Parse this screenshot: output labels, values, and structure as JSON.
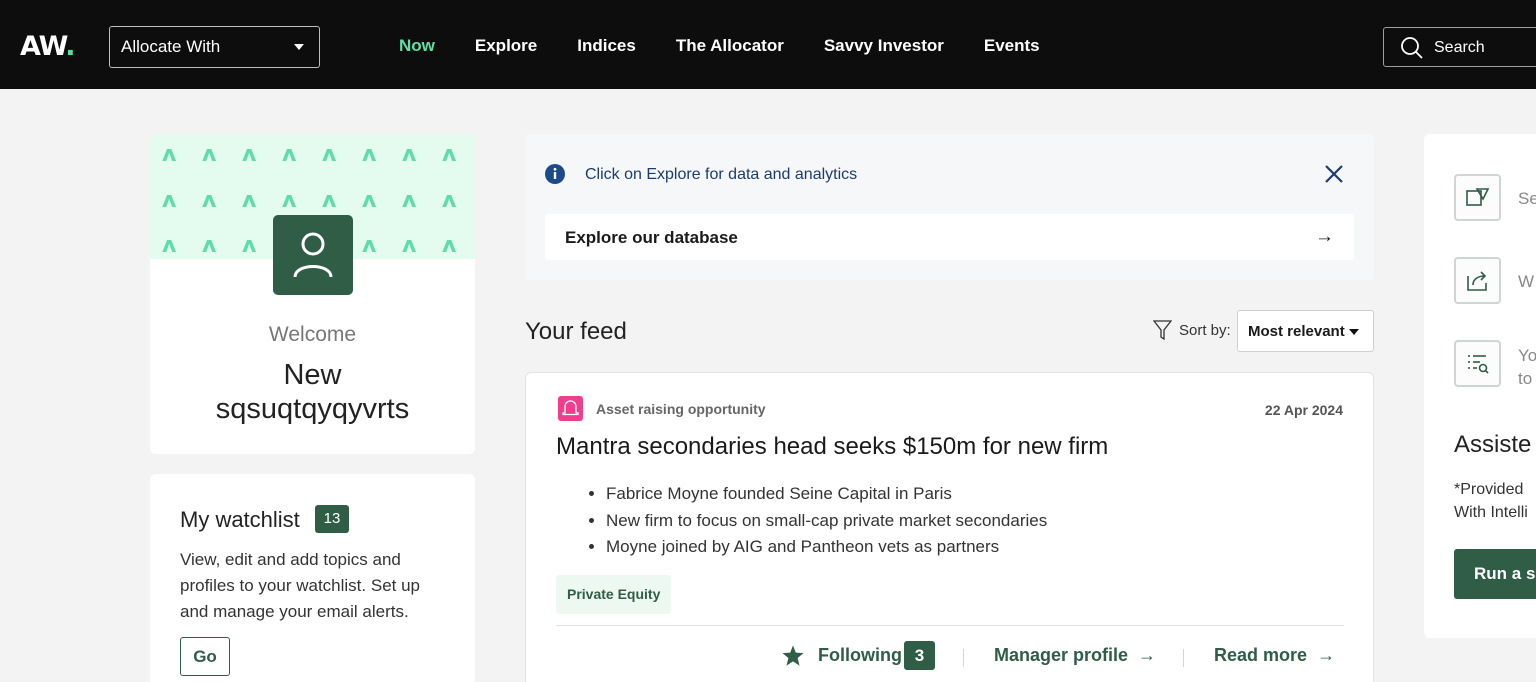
{
  "header": {
    "logo": "AW",
    "logo_dot": ".",
    "allocate_select": "Allocate With",
    "nav": [
      "Now",
      "Explore",
      "Indices",
      "The Allocator",
      "Savvy Investor",
      "Events"
    ],
    "search_label": "Search"
  },
  "profile": {
    "welcome": "Welcome",
    "name_line1": "New",
    "name_line2": "sqsuqtqyqyvrts"
  },
  "watchlist": {
    "title": "My watchlist",
    "count": "13",
    "description": "View, edit and add topics and profiles to your watchlist. Set up and manage your email alerts.",
    "go_label": "Go"
  },
  "banner": {
    "message": "Click on Explore for data and analytics",
    "explore_label": "Explore our database",
    "arrow": "→"
  },
  "feed": {
    "title": "Your feed",
    "sort_label": "Sort by:",
    "sort_value": "Most relevant"
  },
  "article": {
    "category": "Asset raising opportunity",
    "date": "22 Apr 2024",
    "headline": "Mantra secondaries head seeks $150m for new firm",
    "bullets": [
      "Fabrice Moyne founded Seine Capital in Paris",
      "New firm to focus on small-cap private market secondaries",
      "Moyne joined by AIG and Pantheon vets as partners"
    ],
    "tag": "Private Equity",
    "following_label": "Following",
    "following_count": "3",
    "manager_profile": "Manager profile",
    "read_more": "Read more",
    "arrow": "→"
  },
  "right_panel": {
    "items": [
      "Se",
      "W",
      "Yo"
    ],
    "item3_line2": "to",
    "heading": "Assiste",
    "note_line1": "*Provided",
    "note_line2": "With Intelli",
    "button": "Run a se"
  }
}
